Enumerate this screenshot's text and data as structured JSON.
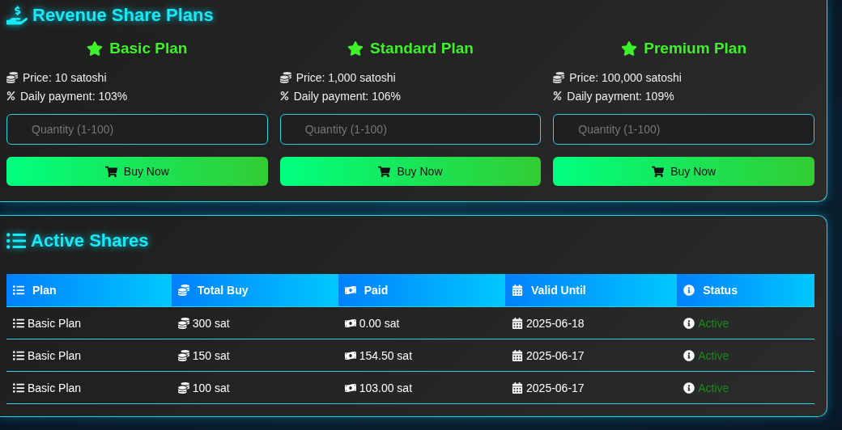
{
  "plans_section": {
    "title": "Revenue Share Plans",
    "plans": [
      {
        "name": "Basic Plan",
        "price": "Price: 10 satoshi",
        "daily": "Daily payment: 103%",
        "placeholder": "Quantity (1-100)",
        "button": "Buy Now"
      },
      {
        "name": "Standard Plan",
        "price": "Price: 1,000 satoshi",
        "daily": "Daily payment: 106%",
        "placeholder": "Quantity (1-100)",
        "button": "Buy Now"
      },
      {
        "name": "Premium Plan",
        "price": "Price: 100,000 satoshi",
        "daily": "Daily payment: 109%",
        "placeholder": "Quantity (1-100)",
        "button": "Buy Now"
      }
    ]
  },
  "shares_section": {
    "title": "Active Shares",
    "table": {
      "columns": [
        "Plan",
        "Total Buy",
        "Paid",
        "Valid Until",
        "Status"
      ],
      "rows": [
        [
          "Basic Plan",
          "300 sat",
          "0.00 sat",
          "2025-06-18",
          "Active"
        ],
        [
          "Basic Plan",
          "150 sat",
          "154.50 sat",
          "2025-06-17",
          "Active"
        ],
        [
          "Basic Plan",
          "100 sat",
          "103.00 sat",
          "2025-06-17",
          "Active"
        ]
      ]
    }
  }
}
